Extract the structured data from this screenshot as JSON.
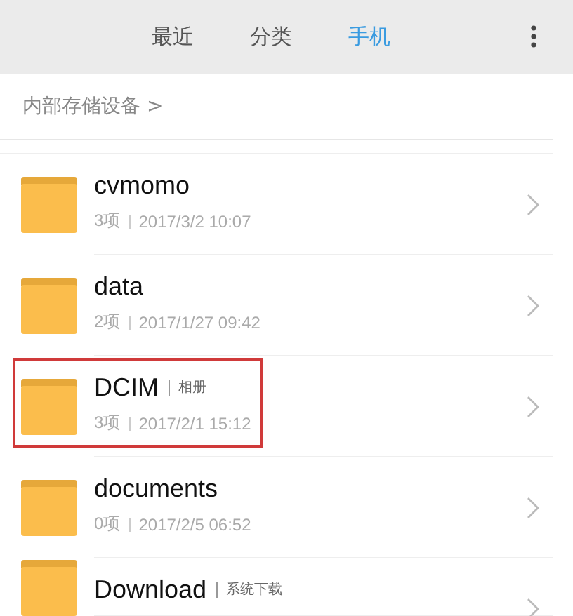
{
  "tabs": [
    {
      "label": "最近",
      "selected": false
    },
    {
      "label": "分类",
      "selected": false
    },
    {
      "label": "手机",
      "selected": true
    }
  ],
  "breadcrumb": {
    "label": "内部存储设备",
    "separator": ">"
  },
  "folders": [
    {
      "name": "cvmomo",
      "count": "3项",
      "date": "2017/3/2 10:07",
      "highlighted": false
    },
    {
      "name": "data",
      "count": "2项",
      "date": "2017/1/27 09:42",
      "highlighted": false
    },
    {
      "name": "DCIM",
      "tag": "相册",
      "count": "3项",
      "date": "2017/2/1 15:12",
      "highlighted": true
    },
    {
      "name": "documents",
      "count": "0项",
      "date": "2017/2/5 06:52",
      "highlighted": false
    },
    {
      "name": "Download",
      "tag": "系统下载",
      "highlighted": false
    }
  ]
}
